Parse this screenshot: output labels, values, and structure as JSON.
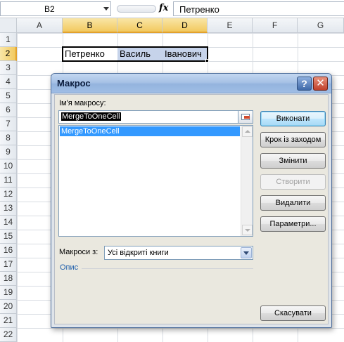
{
  "formula_bar": {
    "name_box": "B2",
    "fx_label": "fx",
    "content": "Петренко"
  },
  "sheet": {
    "columns": [
      "A",
      "B",
      "C",
      "D",
      "E",
      "F",
      "G"
    ],
    "rows": [
      "1",
      "2",
      "3",
      "4",
      "5",
      "6",
      "7",
      "8",
      "9",
      "10",
      "11",
      "12",
      "13",
      "14",
      "15",
      "16",
      "17",
      "18",
      "19",
      "20",
      "21",
      "22"
    ],
    "cells": {
      "B2": "Петренко",
      "C2": "Василь",
      "D2": "Іванович"
    },
    "selected_range": "B2:D2"
  },
  "dialog": {
    "title": "Макрос",
    "help_label": "?",
    "close_label": "✕",
    "macro_name_label": "Ім'я макросу:",
    "macro_name_value": "MergeToOneCell",
    "macro_list": [
      "MergeToOneCell"
    ],
    "buttons": {
      "run": "Виконати",
      "step_into": "Крок із заходом",
      "edit": "Змінити",
      "create": "Створити",
      "delete": "Видалити",
      "options": "Параметри...",
      "cancel": "Скасувати"
    },
    "macros_in_label": "Макроси з:",
    "macros_in_value": "Усі відкриті книги",
    "description_label": "Опис"
  }
}
